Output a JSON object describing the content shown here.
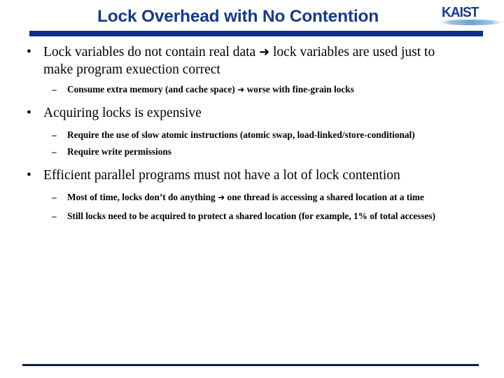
{
  "slide": {
    "title": "Lock Overhead with No Contention",
    "logo": {
      "wordmark": "KAIST",
      "name": "kaist-logo"
    },
    "colors": {
      "title_text": "#173a82",
      "title_rule": "#0a3183",
      "bottom_rule": "#111f3d",
      "logo_wordmark": "#1b3c87",
      "logo_swoosh": "#6fa3d4",
      "body_text": "#000000"
    },
    "bullet_marker": "•",
    "sub_bullet_marker": "–",
    "arrow_glyph": "➜",
    "groups": [
      {
        "level1": {
          "text_before_arrow": "Lock variables do not contain real data ",
          "text_after_arrow": " lock variables are used just to make program exuection correct"
        },
        "level2": [
          {
            "text_before_arrow": "Consume extra memory (and cache space) ",
            "text_after_arrow": " worse with fine-grain locks"
          }
        ]
      },
      {
        "level1": {
          "text_before_arrow": "Acquiring locks is expensive",
          "text_after_arrow": ""
        },
        "level2": [
          {
            "text_before_arrow": "Require the use of slow atomic instructions (atomic swap,  load-linked/store-conditional)",
            "text_after_arrow": ""
          },
          {
            "text_before_arrow": "Require write permissions",
            "text_after_arrow": ""
          }
        ]
      },
      {
        "level1": {
          "text_before_arrow": "Efficient parallel programs must not have a lot of lock contention",
          "text_after_arrow": ""
        },
        "level2": [
          {
            "text_before_arrow": "Most of time, locks don’t do anything ",
            "text_after_arrow": " one thread is accessing a shared location at a time"
          },
          {
            "text_before_arrow": "Still locks need to be acquired to protect a shared location (for example, 1% of total accesses)",
            "text_after_arrow": ""
          }
        ]
      }
    ]
  }
}
